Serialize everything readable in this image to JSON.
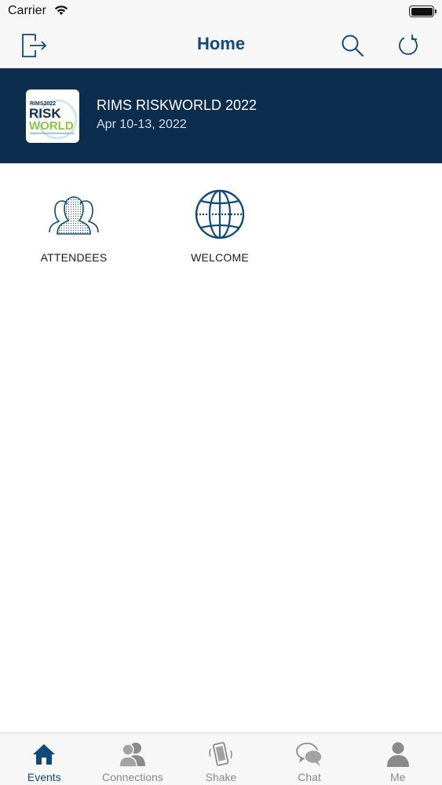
{
  "status_bar": {
    "carrier": "Carrier"
  },
  "nav": {
    "title": "Home"
  },
  "event": {
    "title": "RIMS RISKWORLD 2022",
    "dates": "Apr 10-13, 2022",
    "logo_text": {
      "top": "RIMS2022",
      "line1": "RISK",
      "line2": "WORLD"
    }
  },
  "tiles": [
    {
      "label": "ATTENDEES",
      "icon": "attendees-icon"
    },
    {
      "label": "WELCOME",
      "icon": "globe-icon"
    }
  ],
  "tab_bar": {
    "items": [
      {
        "label": "Events",
        "icon": "home-icon",
        "active": true
      },
      {
        "label": "Connections",
        "icon": "connections-icon",
        "active": false
      },
      {
        "label": "Shake",
        "icon": "shake-phone-icon",
        "active": false
      },
      {
        "label": "Chat",
        "icon": "chat-icon",
        "active": false
      },
      {
        "label": "Me",
        "icon": "person-icon",
        "active": false
      }
    ]
  },
  "colors": {
    "accent": "#0f4a7a",
    "banner": "#0d2d4f",
    "inactive": "#8a8a8a",
    "logo_green": "#8dc63f"
  }
}
